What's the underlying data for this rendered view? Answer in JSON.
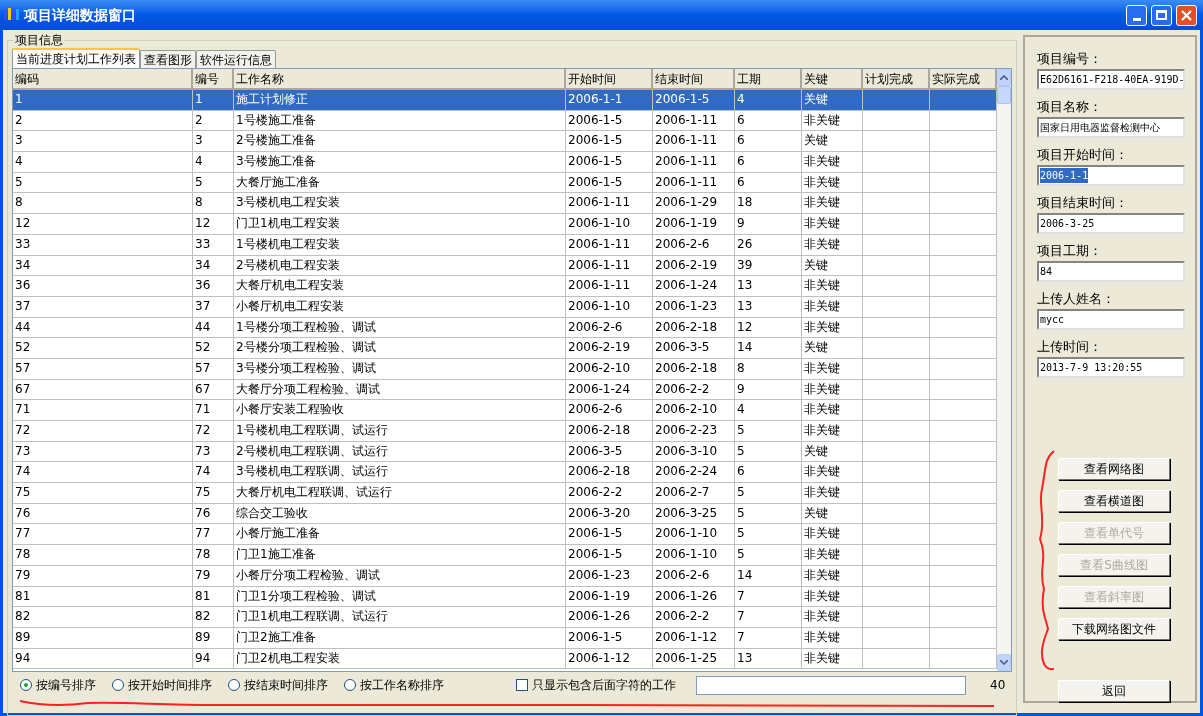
{
  "window": {
    "title": "项目详细数据窗口"
  },
  "group_title": "项目信息",
  "tabs": [
    {
      "label": "当前进度计划工作列表",
      "selected": true
    },
    {
      "label": "查看图形",
      "selected": false
    },
    {
      "label": "软件运行信息",
      "selected": false
    }
  ],
  "table": {
    "columns": [
      "编码",
      "编号",
      "工作名称",
      "开始时间",
      "结束时间",
      "工期",
      "关键",
      "计划完成",
      "实际完成"
    ],
    "rows": [
      {
        "selected": true,
        "cells": [
          "1",
          "1",
          "施工计划修正",
          "2006-1-1",
          "2006-1-5",
          "4",
          "关键"
        ]
      },
      {
        "selected": false,
        "cells": [
          "2",
          "2",
          "1号楼施工准备",
          "2006-1-5",
          "2006-1-11",
          "6",
          "非关键"
        ]
      },
      {
        "selected": false,
        "cells": [
          "3",
          "3",
          "2号楼施工准备",
          "2006-1-5",
          "2006-1-11",
          "6",
          "关键"
        ]
      },
      {
        "selected": false,
        "cells": [
          "4",
          "4",
          "3号楼施工准备",
          "2006-1-5",
          "2006-1-11",
          "6",
          "非关键"
        ]
      },
      {
        "selected": false,
        "cells": [
          "5",
          "5",
          "大餐厅施工准备",
          "2006-1-5",
          "2006-1-11",
          "6",
          "非关键"
        ]
      },
      {
        "selected": false,
        "cells": [
          "8",
          "8",
          "3号楼机电工程安装",
          "2006-1-11",
          "2006-1-29",
          "18",
          "非关键"
        ]
      },
      {
        "selected": false,
        "cells": [
          "12",
          "12",
          "门卫1机电工程安装",
          "2006-1-10",
          "2006-1-19",
          "9",
          "非关键"
        ]
      },
      {
        "selected": false,
        "cells": [
          "33",
          "33",
          "1号楼机电工程安装",
          "2006-1-11",
          "2006-2-6",
          "26",
          "非关键"
        ]
      },
      {
        "selected": false,
        "cells": [
          "34",
          "34",
          "2号楼机电工程安装",
          "2006-1-11",
          "2006-2-19",
          "39",
          "关键"
        ]
      },
      {
        "selected": false,
        "cells": [
          "36",
          "36",
          "大餐厅机电工程安装",
          "2006-1-11",
          "2006-1-24",
          "13",
          "非关键"
        ]
      },
      {
        "selected": false,
        "cells": [
          "37",
          "37",
          "小餐厅机电工程安装",
          "2006-1-10",
          "2006-1-23",
          "13",
          "非关键"
        ]
      },
      {
        "selected": false,
        "cells": [
          "44",
          "44",
          "1号楼分项工程检验、调试",
          "2006-2-6",
          "2006-2-18",
          "12",
          "非关键"
        ]
      },
      {
        "selected": false,
        "cells": [
          "52",
          "52",
          "2号楼分项工程检验、调试",
          "2006-2-19",
          "2006-3-5",
          "14",
          "关键"
        ]
      },
      {
        "selected": false,
        "cells": [
          "57",
          "57",
          "3号楼分项工程检验、调试",
          "2006-2-10",
          "2006-2-18",
          "8",
          "非关键"
        ]
      },
      {
        "selected": false,
        "cells": [
          "67",
          "67",
          "大餐厅分项工程检验、调试",
          "2006-1-24",
          "2006-2-2",
          "9",
          "非关键"
        ]
      },
      {
        "selected": false,
        "cells": [
          "71",
          "71",
          "小餐厅安装工程验收",
          "2006-2-6",
          "2006-2-10",
          "4",
          "非关键"
        ]
      },
      {
        "selected": false,
        "cells": [
          "72",
          "72",
          "1号楼机电工程联调、试运行",
          "2006-2-18",
          "2006-2-23",
          "5",
          "非关键"
        ]
      },
      {
        "selected": false,
        "cells": [
          "73",
          "73",
          "2号楼机电工程联调、试运行",
          "2006-3-5",
          "2006-3-10",
          "5",
          "关键"
        ]
      },
      {
        "selected": false,
        "cells": [
          "74",
          "74",
          "3号楼机电工程联调、试运行",
          "2006-2-18",
          "2006-2-24",
          "6",
          "非关键"
        ]
      },
      {
        "selected": false,
        "cells": [
          "75",
          "75",
          "大餐厅机电工程联调、试运行",
          "2006-2-2",
          "2006-2-7",
          "5",
          "非关键"
        ]
      },
      {
        "selected": false,
        "cells": [
          "76",
          "76",
          "综合交工验收",
          "2006-3-20",
          "2006-3-25",
          "5",
          "关键"
        ]
      },
      {
        "selected": false,
        "cells": [
          "77",
          "77",
          "小餐厅施工准备",
          "2006-1-5",
          "2006-1-10",
          "5",
          "非关键"
        ]
      },
      {
        "selected": false,
        "cells": [
          "78",
          "78",
          "门卫1施工准备",
          "2006-1-5",
          "2006-1-10",
          "5",
          "非关键"
        ]
      },
      {
        "selected": false,
        "cells": [
          "79",
          "79",
          "小餐厅分项工程检验、调试",
          "2006-1-23",
          "2006-2-6",
          "14",
          "非关键"
        ]
      },
      {
        "selected": false,
        "cells": [
          "81",
          "81",
          "门卫1分项工程检验、调试",
          "2006-1-19",
          "2006-1-26",
          "7",
          "非关键"
        ]
      },
      {
        "selected": false,
        "cells": [
          "82",
          "82",
          "门卫1机电工程联调、试运行",
          "2006-1-26",
          "2006-2-2",
          "7",
          "非关键"
        ]
      },
      {
        "selected": false,
        "cells": [
          "89",
          "89",
          "门卫2施工准备",
          "2006-1-5",
          "2006-1-12",
          "7",
          "非关键"
        ]
      },
      {
        "selected": false,
        "cells": [
          "94",
          "94",
          "门卫2机电工程安装",
          "2006-1-12",
          "2006-1-25",
          "13",
          "非关键"
        ]
      }
    ]
  },
  "sort_options": [
    {
      "label": "按编号排序",
      "selected": true
    },
    {
      "label": "按开始时间排序",
      "selected": false
    },
    {
      "label": "按结束时间排序",
      "selected": false
    },
    {
      "label": "按工作名称排序",
      "selected": false
    }
  ],
  "filter": {
    "label": "只显示包含后面字符的工作",
    "checked": false
  },
  "count": "40",
  "fields": [
    {
      "label": "项目编号：",
      "value": "E62D6161-F218-40EA-919D-",
      "highlighted": false
    },
    {
      "label": "项目名称：",
      "value": "国家日用电器监督检测中心",
      "highlighted": false
    },
    {
      "label": "项目开始时间：",
      "value": "2006-1-1",
      "highlighted": true
    },
    {
      "label": "项目结束时间：",
      "value": "2006-3-25",
      "highlighted": false
    },
    {
      "label": "项目工期：",
      "value": "84",
      "highlighted": false
    },
    {
      "label": "上传人姓名：",
      "value": "mycc",
      "highlighted": false
    },
    {
      "label": "上传时间：",
      "value": "2013-7-9 13:20:55",
      "highlighted": false
    }
  ],
  "buttons": [
    {
      "label": "查看网络图",
      "disabled": false
    },
    {
      "label": "查看横道图",
      "disabled": false
    },
    {
      "label": "查看单代号",
      "disabled": true
    },
    {
      "label": "查看S曲线图",
      "disabled": true
    },
    {
      "label": "查看斜率图",
      "disabled": true
    },
    {
      "label": "下载网络图文件",
      "disabled": false
    }
  ],
  "back_button": "返回"
}
